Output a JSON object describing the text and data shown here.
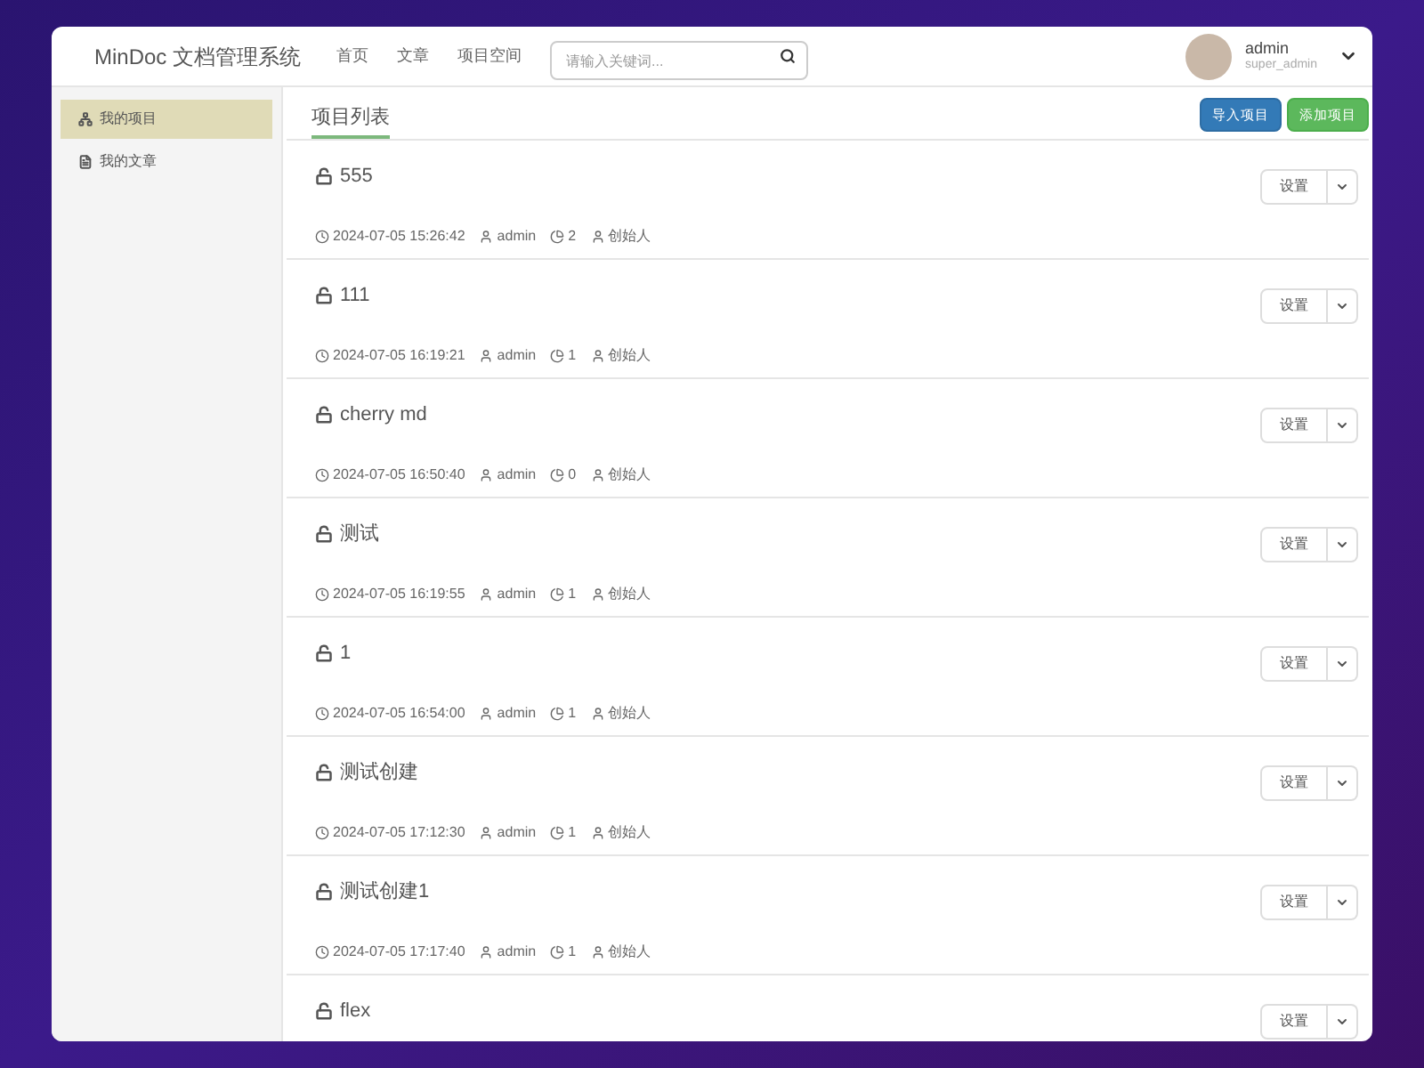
{
  "brand": "MinDoc 文档管理系统",
  "nav": [
    {
      "label": "首页"
    },
    {
      "label": "文章"
    },
    {
      "label": "项目空间"
    }
  ],
  "search": {
    "placeholder": "请输入关键词..."
  },
  "user": {
    "name": "admin",
    "role": "super_admin"
  },
  "sidebar": {
    "items": [
      {
        "label": "我的项目",
        "selected": true
      },
      {
        "label": "我的文章",
        "selected": false
      }
    ]
  },
  "content": {
    "title": "项目列表",
    "buttons": [
      {
        "label": "导入项目",
        "kind": "primary"
      },
      {
        "label": "添加项目",
        "kind": "success"
      }
    ]
  },
  "projects": [
    {
      "title": "555",
      "time": "2024-07-05 15:26:42",
      "author": "admin",
      "count": "2",
      "role": "创始人",
      "button": "设置"
    },
    {
      "title": "111",
      "time": "2024-07-05 16:19:21",
      "author": "admin",
      "count": "1",
      "role": "创始人",
      "button": "设置"
    },
    {
      "title": "cherry md",
      "time": "2024-07-05 16:50:40",
      "author": "admin",
      "count": "0",
      "role": "创始人",
      "button": "设置"
    },
    {
      "title": "测试",
      "time": "2024-07-05 16:19:55",
      "author": "admin",
      "count": "1",
      "role": "创始人",
      "button": "设置"
    },
    {
      "title": "1",
      "time": "2024-07-05 16:54:00",
      "author": "admin",
      "count": "1",
      "role": "创始人",
      "button": "设置"
    },
    {
      "title": "测试创建",
      "time": "2024-07-05 17:12:30",
      "author": "admin",
      "count": "1",
      "role": "创始人",
      "button": "设置"
    },
    {
      "title": "测试创建1",
      "time": "2024-07-05 17:17:40",
      "author": "admin",
      "count": "1",
      "role": "创始人",
      "button": "设置"
    },
    {
      "title": "flex",
      "button": "设置"
    }
  ]
}
